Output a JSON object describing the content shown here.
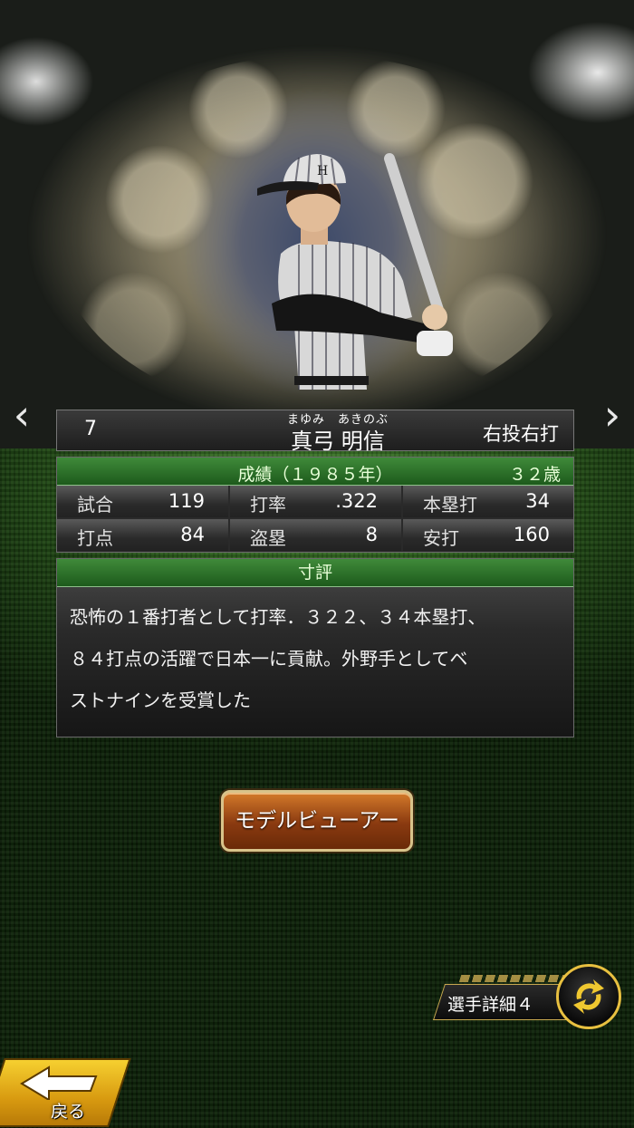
{
  "player": {
    "number": "7",
    "name_ruby": "まゆみ　あきのぶ",
    "name": "真弓 明信",
    "handedness": "右投右打"
  },
  "stats": {
    "header": "成績（１９８５年）",
    "age": "３２歳",
    "items": [
      {
        "label": "試合",
        "value": "119"
      },
      {
        "label": "打率",
        "value": ".322"
      },
      {
        "label": "本塁打",
        "value": "34"
      },
      {
        "label": "打点",
        "value": "84"
      },
      {
        "label": "盗塁",
        "value": "8"
      },
      {
        "label": "安打",
        "value": "160"
      }
    ]
  },
  "comment": {
    "header": "寸評",
    "lines": [
      "恐怖の１番打者として打率．３２２、３４本塁打、",
      "８４打点の活躍で日本一に貢献。外野手としてベ",
      "ストナインを受賞した"
    ]
  },
  "buttons": {
    "model_viewer": "モデルビューアー",
    "player_detail": "選手詳細４",
    "back": "戻る"
  },
  "nav": {
    "prev": "‹",
    "next": "›"
  },
  "colors": {
    "panel_header_green": "#2f7a2c",
    "accent_gold": "#e8c040",
    "button_brown": "#8a3a10",
    "back_yellow": "#f0c020"
  }
}
